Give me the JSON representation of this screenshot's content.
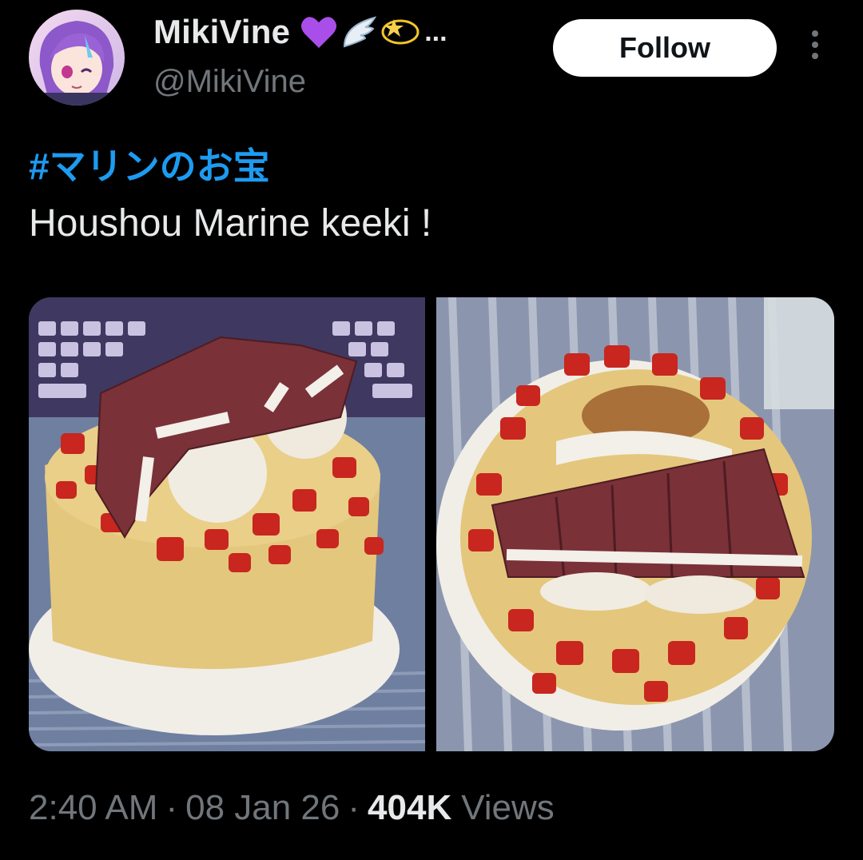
{
  "author": {
    "display_name": "MikiVine",
    "name_icons": [
      "purple-heart-icon",
      "wing-icon",
      "dizzy-star-icon"
    ],
    "name_truncation": "...",
    "handle": "@MikiVine",
    "avatar": "avatar-anime-character"
  },
  "actions": {
    "follow_label": "Follow",
    "more_icon": "more-vertical-icon"
  },
  "tweet": {
    "hashtag": "#マリンのお宝",
    "text": "Houshou Marine keeki !"
  },
  "media": {
    "photos": [
      {
        "description_icon": "cake-photo-left"
      },
      {
        "description_icon": "cake-photo-right"
      }
    ]
  },
  "meta": {
    "time": "2:40 AM",
    "separator": "·",
    "date": "08 Jan 26",
    "views_count": "404K",
    "views_label": "Views"
  },
  "colors": {
    "background": "#000000",
    "primary_text": "#e7e9ea",
    "secondary_text": "#71767b",
    "link": "#1d9bf0",
    "follow_bg": "#ffffff"
  }
}
